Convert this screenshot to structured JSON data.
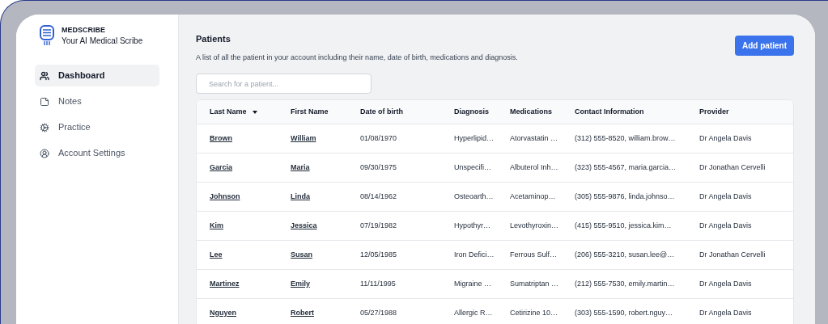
{
  "brand": {
    "name": "MEDSCRIBE",
    "tagline": "Your AI Medical Scribe"
  },
  "sidebar": {
    "items": [
      {
        "label": "Dashboard",
        "selected": true
      },
      {
        "label": "Notes",
        "selected": false
      },
      {
        "label": "Practice",
        "selected": false
      },
      {
        "label": "Account Settings",
        "selected": false
      }
    ]
  },
  "header": {
    "title": "Patients",
    "description": "A list of all the patient in your account including their name, date of birth, medications and diagnosis.",
    "action": "Add patient"
  },
  "search": {
    "placeholder": "Search for a patient..."
  },
  "table": {
    "columns": [
      {
        "label": "Last Name",
        "sorted": true,
        "kind": "link"
      },
      {
        "label": "First Name",
        "sorted": false,
        "kind": "link"
      },
      {
        "label": "Date of birth",
        "sorted": false,
        "kind": "text"
      },
      {
        "label": "Diagnosis",
        "sorted": false,
        "kind": "text"
      },
      {
        "label": "Medications",
        "sorted": false,
        "kind": "text"
      },
      {
        "label": "Contact Information",
        "sorted": false,
        "kind": "text"
      },
      {
        "label": "Provider",
        "sorted": false,
        "kind": "text"
      }
    ],
    "rows": [
      [
        "Brown",
        "William",
        "01/08/1970",
        "Hyperlipid…",
        "Atorvastatin …",
        "(312) 555-8520, william.brow…",
        "Dr Angela Davis"
      ],
      [
        "Garcia",
        "Maria",
        "09/30/1975",
        "Unspecifi…",
        "Albuterol Inh…",
        "(323) 555-4567, maria.garcia…",
        "Dr Jonathan Cervelli"
      ],
      [
        "Johnson",
        "Linda",
        "08/14/1962",
        "Osteoarth…",
        "Acetaminop…",
        "(305) 555-9876, linda.johnso…",
        "Dr Angela Davis"
      ],
      [
        "Kim",
        "Jessica",
        "07/19/1982",
        "Hypothyr…",
        "Levothyroxin…",
        "(415) 555-9510, jessica.kim…",
        "Dr Angela Davis"
      ],
      [
        "Lee",
        "Susan",
        "12/05/1985",
        "Iron Defici…",
        "Ferrous Sulf…",
        "(206) 555-3210, susan.lee@…",
        "Dr Jonathan Cervelli"
      ],
      [
        "Martinez",
        "Emily",
        "11/11/1995",
        "Migraine …",
        "Sumatriptan …",
        "(212) 555-7530, emily.martin…",
        "Dr Angela Davis"
      ],
      [
        "Nguyen",
        "Robert",
        "05/27/1988",
        "Allergic R…",
        "Cetirizine 10…",
        "(303) 555-1590, robert.nguy…",
        "Dr Angela Davis"
      ]
    ]
  }
}
